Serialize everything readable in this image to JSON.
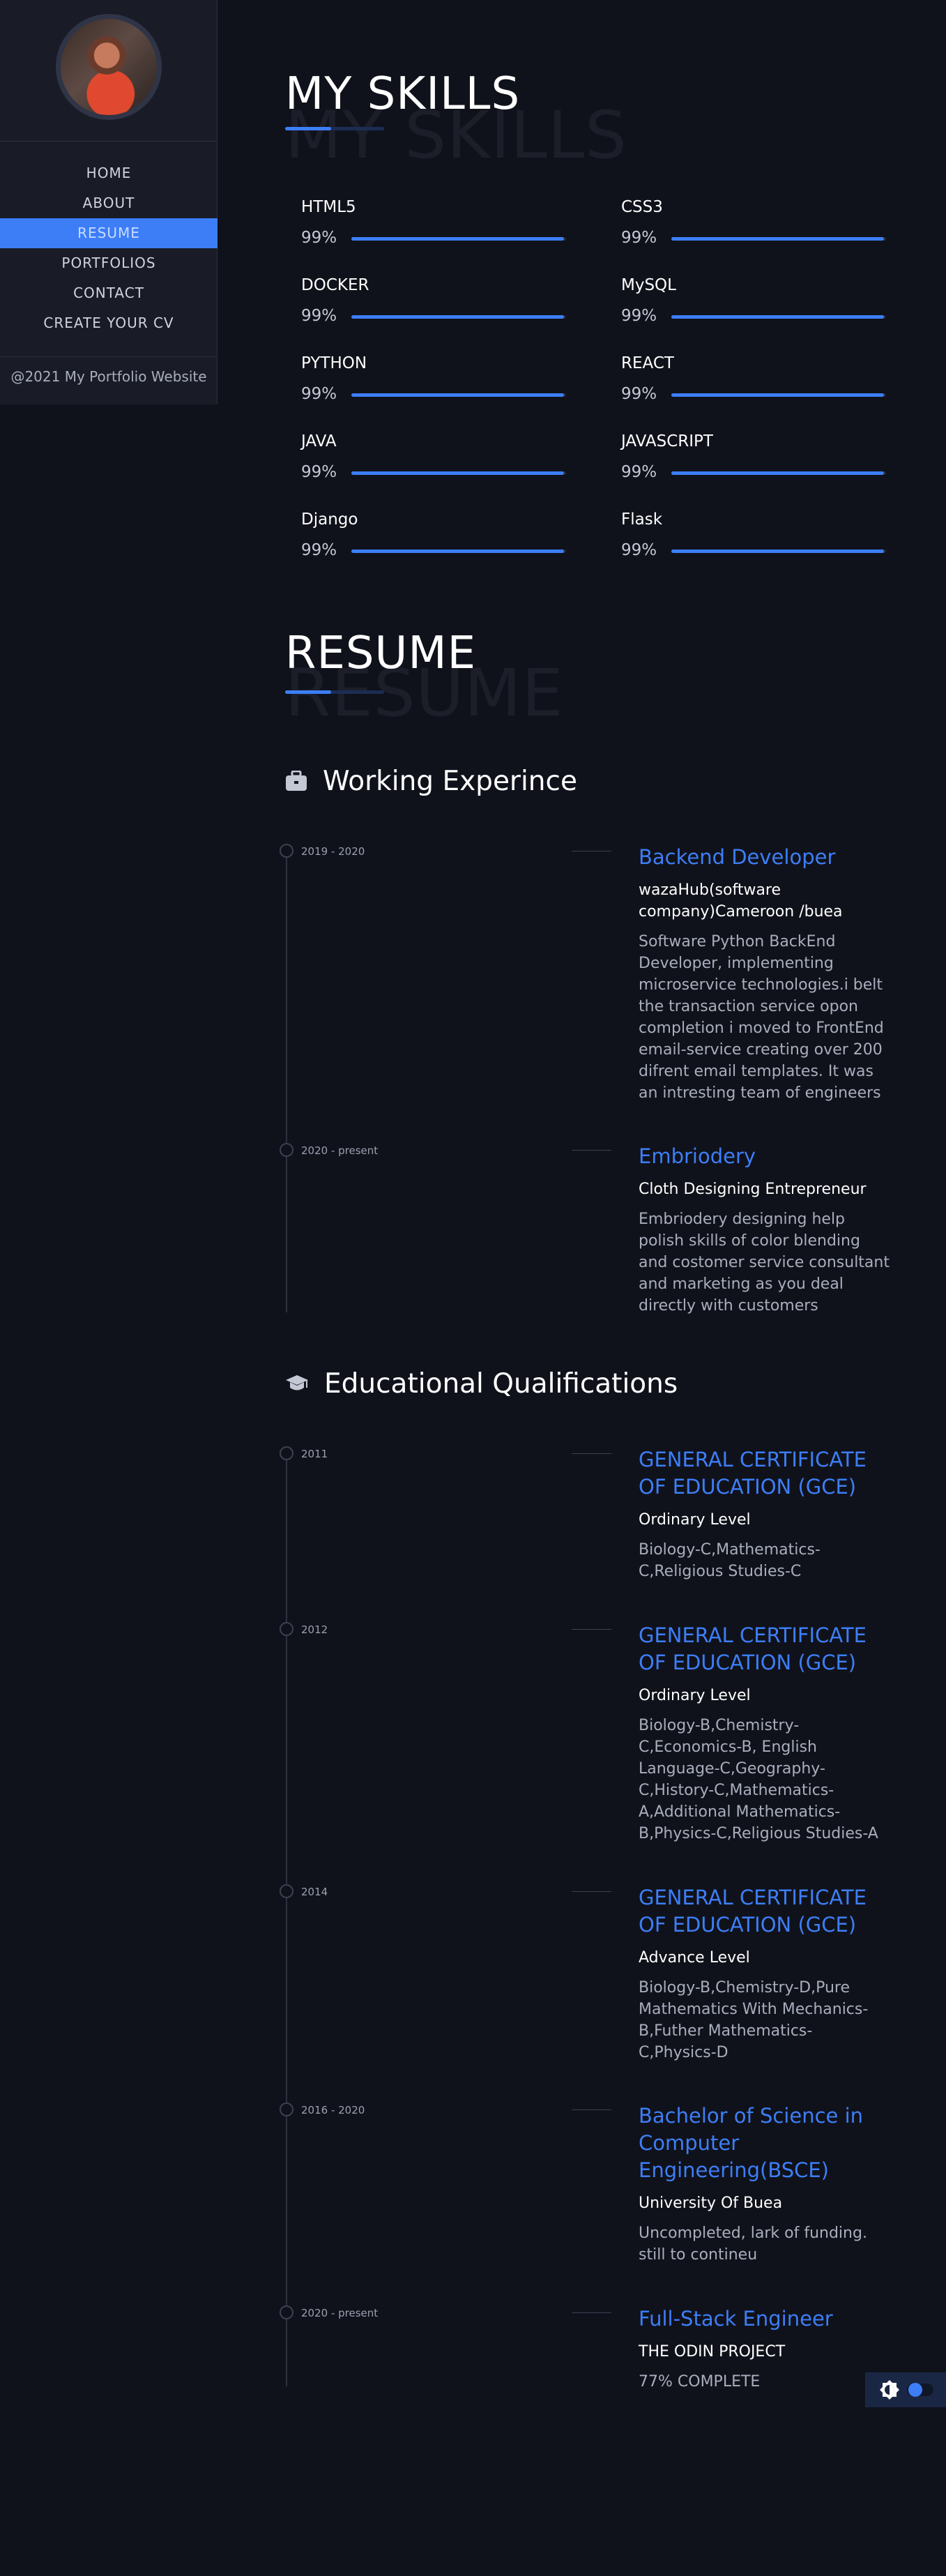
{
  "sidebar": {
    "nav": [
      {
        "label": "HOME",
        "active": false
      },
      {
        "label": "ABOUT",
        "active": false
      },
      {
        "label": "RESUME",
        "active": true
      },
      {
        "label": "PORTFOLIOS",
        "active": false
      },
      {
        "label": "CONTACT",
        "active": false
      },
      {
        "label": "CREATE YOUR CV",
        "active": false
      }
    ],
    "footer": "@2021 My Portfolio Website"
  },
  "skills_section": {
    "title": "MY SKILLS",
    "ghost": "MY SKILLS",
    "skills": [
      {
        "name": "HTML5",
        "percent_label": "99%",
        "level": 99
      },
      {
        "name": "CSS3",
        "percent_label": "99%",
        "level": 99
      },
      {
        "name": "DOCKER",
        "percent_label": "99%",
        "level": 99
      },
      {
        "name": "MySQL",
        "percent_label": "99%",
        "level": 99
      },
      {
        "name": "PYTHON",
        "percent_label": "99%",
        "level": 99
      },
      {
        "name": "REACT",
        "percent_label": "99%",
        "level": 99
      },
      {
        "name": "JAVA",
        "percent_label": "99%",
        "level": 99
      },
      {
        "name": "JAVASCRIPT",
        "percent_label": "99%",
        "level": 99
      },
      {
        "name": "Django",
        "percent_label": "99%",
        "level": 99
      },
      {
        "name": "Flask",
        "percent_label": "99%",
        "level": 99
      }
    ]
  },
  "resume_section": {
    "title": "RESUME",
    "ghost": "RESUME",
    "work": {
      "heading": "Working Experince",
      "icon": "briefcase-icon",
      "items": [
        {
          "date": "2019 - 2020",
          "title": "Backend Developer",
          "subtitle": "wazaHub(software company)Cameroon /buea",
          "description": "Software Python BackEnd Developer, implementing microservice technologies.i belt the transaction service opon completion i moved to FrontEnd email-service creating over 200 difrent email templates. It was an intresting team of engineers"
        },
        {
          "date": "2020 - present",
          "title": "Embriodery",
          "subtitle": "Cloth Designing Entrepreneur",
          "description": "Embriodery designing help polish skills of color blending and costomer service consultant and marketing as you deal directly with customers"
        }
      ]
    },
    "education": {
      "heading": "Educational Qualifications",
      "icon": "graduation-cap-icon",
      "items": [
        {
          "date": "2011",
          "title": "GENERAL CERTIFICATE OF EDUCATION (GCE)",
          "subtitle": "Ordinary Level",
          "description": "Biology-C,Mathematics-C,Religious Studies-C"
        },
        {
          "date": "2012",
          "title": "GENERAL CERTIFICATE OF EDUCATION (GCE)",
          "subtitle": "Ordinary Level",
          "description": "Biology-B,Chemistry-C,Economics-B, English Language-C,Geography-C,History-C,Mathematics-A,Additional Mathematics-B,Physics-C,Religious Studies-A"
        },
        {
          "date": "2014",
          "title": "GENERAL CERTIFICATE OF EDUCATION (GCE)",
          "subtitle": "Advance Level",
          "description": "Biology-B,Chemistry-D,Pure Mathematics With Mechanics-B,Futher Mathematics-C,Physics-D"
        },
        {
          "date": "2016 - 2020",
          "title": "Bachelor of Science in Computer Engineering(BSCE)",
          "subtitle": "University Of Buea",
          "description": "Uncompleted, lark of funding. still to contineu"
        },
        {
          "date": "2020 - present",
          "title": "Full-Stack Engineer",
          "subtitle": "THE ODIN PROJECT",
          "description": "77% COMPLETE"
        }
      ]
    }
  },
  "theme_toggle": {
    "icon": "brightness-icon",
    "state": "dark"
  },
  "colors": {
    "accent": "#3d7ef7",
    "background": "#10121b",
    "sidebar": "#191c27"
  }
}
